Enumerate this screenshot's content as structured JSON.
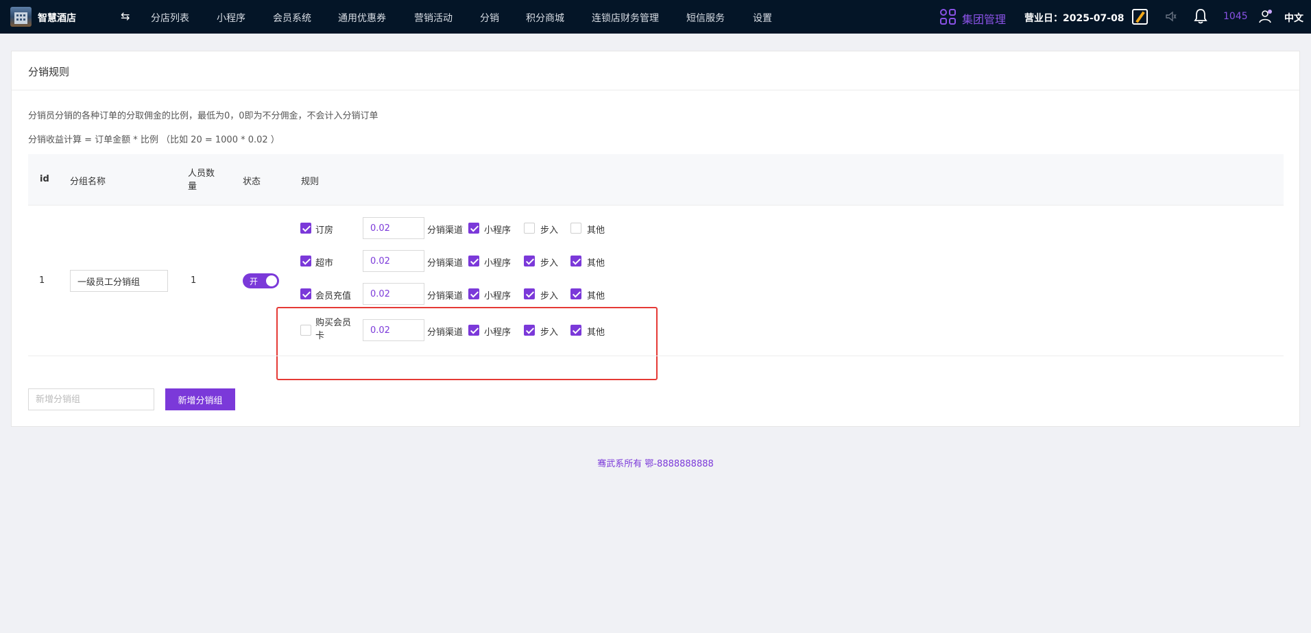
{
  "header": {
    "app_name": "智慧酒店",
    "swap_symbol": "⇆",
    "nav": [
      {
        "label": "分店列表",
        "bold": true
      },
      {
        "label": "小程序"
      },
      {
        "label": "会员系统"
      },
      {
        "label": "通用优惠券"
      },
      {
        "label": "营销活动"
      },
      {
        "label": "分销",
        "bold": true
      },
      {
        "label": "积分商城"
      },
      {
        "label": "连锁店财务管理"
      },
      {
        "label": "短信服务"
      },
      {
        "label": "设置"
      }
    ],
    "group_manage": "集团管理",
    "business_day": "营业日：2025-07-08",
    "notification_count": "1045",
    "language": "中文",
    "accent_color": "#8a52e6"
  },
  "page": {
    "title": "分销规则",
    "note1": "分销员分销的各种订单的分取佣金的比例，最低为0，0即为不分佣金，不会计入分销订单",
    "note2": "分销收益计算 = 订单金额 * 比例 （比如 20 = 1000 * 0.02 ）"
  },
  "table": {
    "headers": {
      "id": "id",
      "name": "分组名称",
      "count": "人员数量",
      "status": "状态",
      "rule": "规则"
    },
    "row": {
      "id": "1",
      "group_name": "一级员工分销组",
      "member_count": "1",
      "status_label": "开",
      "status_on": true,
      "rules": [
        {
          "label": "订房",
          "enabled": true,
          "rate": "0.02",
          "channel_label": "分销渠道",
          "channels": [
            {
              "label": "小程序",
              "checked": true
            },
            {
              "label": "步入",
              "checked": false
            },
            {
              "label": "其他",
              "checked": false
            }
          ]
        },
        {
          "label": "超市",
          "enabled": true,
          "rate": "0.02",
          "channel_label": "分销渠道",
          "channels": [
            {
              "label": "小程序",
              "checked": true
            },
            {
              "label": "步入",
              "checked": true
            },
            {
              "label": "其他",
              "checked": true
            }
          ]
        },
        {
          "label": "会员充值",
          "enabled": true,
          "rate": "0.02",
          "channel_label": "分销渠道",
          "channels": [
            {
              "label": "小程序",
              "checked": true
            },
            {
              "label": "步入",
              "checked": true
            },
            {
              "label": "其他",
              "checked": true
            }
          ]
        },
        {
          "label": "购买会员卡",
          "enabled": false,
          "rate": "0.02",
          "channel_label": "分销渠道",
          "channels": [
            {
              "label": "小程序",
              "checked": true
            },
            {
              "label": "步入",
              "checked": true
            },
            {
              "label": "其他",
              "checked": true
            }
          ]
        }
      ]
    }
  },
  "add_group": {
    "placeholder": "新增分销组",
    "value": "",
    "button_label": "新增分销组"
  },
  "footer": {
    "text": "骞武系所有 鄂-8888888888"
  },
  "colors": {
    "primary": "#7b39d9",
    "topbar": "#041527",
    "highlight_border": "#e53935"
  }
}
